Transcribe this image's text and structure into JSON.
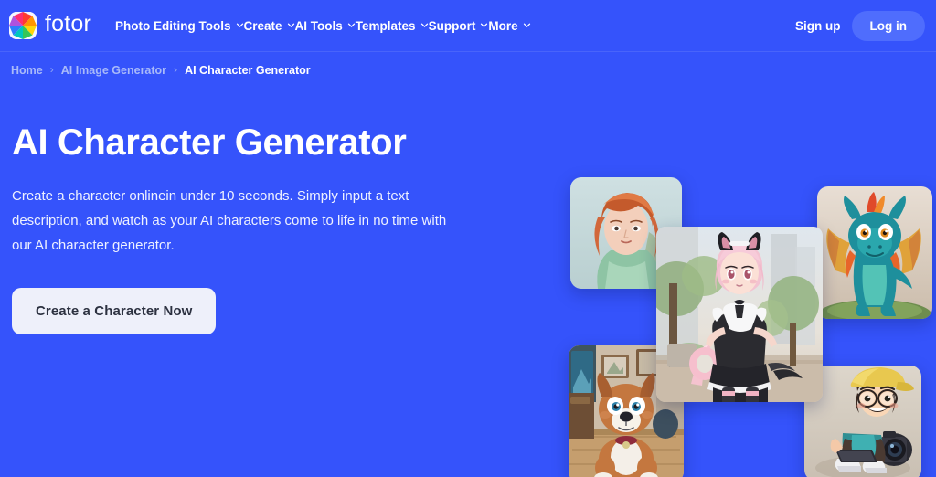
{
  "navbar": {
    "brand_name": "fotor",
    "brand_icon": "fotor-logo-icon",
    "menu": [
      {
        "label": "Photo Editing Tools",
        "has_dropdown": true
      },
      {
        "label": "Create",
        "has_dropdown": true
      },
      {
        "label": "AI Tools",
        "has_dropdown": true
      },
      {
        "label": "Templates",
        "has_dropdown": true
      },
      {
        "label": "Support",
        "has_dropdown": true
      },
      {
        "label": "More",
        "has_dropdown": true
      }
    ],
    "signup_label": "Sign up",
    "login_label": "Log in"
  },
  "breadcrumb": {
    "separator": "›",
    "items": [
      {
        "label": "Home",
        "current": false
      },
      {
        "label": "AI Image Generator",
        "current": false
      },
      {
        "label": "AI Character Generator",
        "current": true
      }
    ]
  },
  "hero": {
    "title": "AI Character Generator",
    "description": "Create a character onlinein under 10 seconds. Simply input a text description, and watch as your AI characters come to life in no time with our AI character generator.",
    "cta_label": "Create a Character Now"
  },
  "collage": {
    "images": [
      {
        "name": "red-haired-woman-character",
        "alt": "Illustrated red-haired woman wearing a green hooded cloak"
      },
      {
        "name": "teal-dragon-character",
        "alt": "Teal cartoon dragon with orange wings standing on grass"
      },
      {
        "name": "anime-catgirl-character",
        "alt": "Anime catgirl with pink hair in a black maid dress on a city street"
      },
      {
        "name": "cartoon-dog-character",
        "alt": "Cartoon brown and white dog sitting indoors wearing a collar"
      },
      {
        "name": "cartoon-boy-photographer-character",
        "alt": "Cartoon boy with yellow cap and glasses holding a tablet beside a camera"
      }
    ]
  },
  "colors": {
    "page_background": "#3553fb",
    "login_button": "#4f6dfd",
    "cta_button_background": "#eef0fa",
    "cta_button_text": "#2c3140",
    "breadcrumb_link": "#a9baf9",
    "breadcrumb_current": "#ffffff"
  }
}
